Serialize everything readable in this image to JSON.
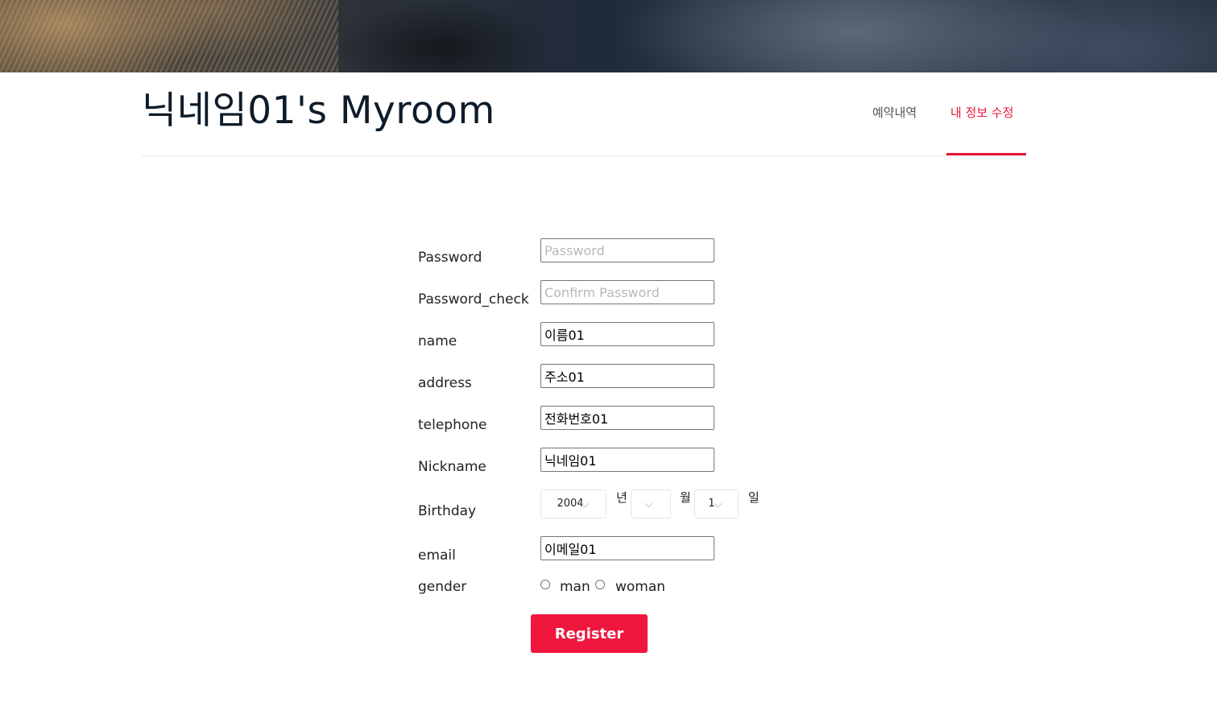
{
  "header": {
    "title": "닉네임01's Myroom",
    "nav": [
      {
        "label": "예약내역"
      },
      {
        "label": "내 정보 수정",
        "active": true
      }
    ],
    "accent_color": "#e8163b"
  },
  "form": {
    "password": {
      "label": "Password",
      "placeholder": "Password",
      "value": ""
    },
    "password_check": {
      "label": "Password_check",
      "placeholder": "Confirm Password",
      "value": ""
    },
    "name": {
      "label": "name",
      "value": "이름01"
    },
    "address": {
      "label": "address",
      "value": "주소01"
    },
    "telephone": {
      "label": "telephone",
      "value": "전화번호01"
    },
    "nickname": {
      "label": "Nickname",
      "value": "닉네임01"
    },
    "birthday": {
      "label": "Birthday",
      "year": "2004",
      "year_unit": "년",
      "month": "",
      "month_unit": "월",
      "day": "1",
      "day_unit": "일"
    },
    "email": {
      "label": "email",
      "value": "이메일01"
    },
    "gender": {
      "label": "gender",
      "options": [
        "man",
        "woman"
      ]
    },
    "submit_label": "Register",
    "submit_color": "#f0173f"
  }
}
